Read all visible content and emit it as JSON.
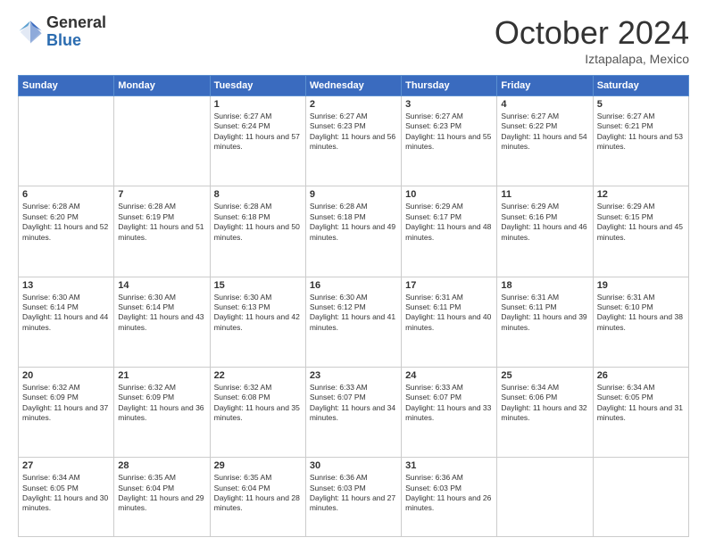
{
  "logo": {
    "general": "General",
    "blue": "Blue"
  },
  "header": {
    "month": "October 2024",
    "location": "Iztapalapa, Mexico"
  },
  "days_of_week": [
    "Sunday",
    "Monday",
    "Tuesday",
    "Wednesday",
    "Thursday",
    "Friday",
    "Saturday"
  ],
  "weeks": [
    [
      {
        "day": "",
        "info": ""
      },
      {
        "day": "",
        "info": ""
      },
      {
        "day": "1",
        "info": "Sunrise: 6:27 AM\nSunset: 6:24 PM\nDaylight: 11 hours and 57 minutes."
      },
      {
        "day": "2",
        "info": "Sunrise: 6:27 AM\nSunset: 6:23 PM\nDaylight: 11 hours and 56 minutes."
      },
      {
        "day": "3",
        "info": "Sunrise: 6:27 AM\nSunset: 6:23 PM\nDaylight: 11 hours and 55 minutes."
      },
      {
        "day": "4",
        "info": "Sunrise: 6:27 AM\nSunset: 6:22 PM\nDaylight: 11 hours and 54 minutes."
      },
      {
        "day": "5",
        "info": "Sunrise: 6:27 AM\nSunset: 6:21 PM\nDaylight: 11 hours and 53 minutes."
      }
    ],
    [
      {
        "day": "6",
        "info": "Sunrise: 6:28 AM\nSunset: 6:20 PM\nDaylight: 11 hours and 52 minutes."
      },
      {
        "day": "7",
        "info": "Sunrise: 6:28 AM\nSunset: 6:19 PM\nDaylight: 11 hours and 51 minutes."
      },
      {
        "day": "8",
        "info": "Sunrise: 6:28 AM\nSunset: 6:18 PM\nDaylight: 11 hours and 50 minutes."
      },
      {
        "day": "9",
        "info": "Sunrise: 6:28 AM\nSunset: 6:18 PM\nDaylight: 11 hours and 49 minutes."
      },
      {
        "day": "10",
        "info": "Sunrise: 6:29 AM\nSunset: 6:17 PM\nDaylight: 11 hours and 48 minutes."
      },
      {
        "day": "11",
        "info": "Sunrise: 6:29 AM\nSunset: 6:16 PM\nDaylight: 11 hours and 46 minutes."
      },
      {
        "day": "12",
        "info": "Sunrise: 6:29 AM\nSunset: 6:15 PM\nDaylight: 11 hours and 45 minutes."
      }
    ],
    [
      {
        "day": "13",
        "info": "Sunrise: 6:30 AM\nSunset: 6:14 PM\nDaylight: 11 hours and 44 minutes."
      },
      {
        "day": "14",
        "info": "Sunrise: 6:30 AM\nSunset: 6:14 PM\nDaylight: 11 hours and 43 minutes."
      },
      {
        "day": "15",
        "info": "Sunrise: 6:30 AM\nSunset: 6:13 PM\nDaylight: 11 hours and 42 minutes."
      },
      {
        "day": "16",
        "info": "Sunrise: 6:30 AM\nSunset: 6:12 PM\nDaylight: 11 hours and 41 minutes."
      },
      {
        "day": "17",
        "info": "Sunrise: 6:31 AM\nSunset: 6:11 PM\nDaylight: 11 hours and 40 minutes."
      },
      {
        "day": "18",
        "info": "Sunrise: 6:31 AM\nSunset: 6:11 PM\nDaylight: 11 hours and 39 minutes."
      },
      {
        "day": "19",
        "info": "Sunrise: 6:31 AM\nSunset: 6:10 PM\nDaylight: 11 hours and 38 minutes."
      }
    ],
    [
      {
        "day": "20",
        "info": "Sunrise: 6:32 AM\nSunset: 6:09 PM\nDaylight: 11 hours and 37 minutes."
      },
      {
        "day": "21",
        "info": "Sunrise: 6:32 AM\nSunset: 6:09 PM\nDaylight: 11 hours and 36 minutes."
      },
      {
        "day": "22",
        "info": "Sunrise: 6:32 AM\nSunset: 6:08 PM\nDaylight: 11 hours and 35 minutes."
      },
      {
        "day": "23",
        "info": "Sunrise: 6:33 AM\nSunset: 6:07 PM\nDaylight: 11 hours and 34 minutes."
      },
      {
        "day": "24",
        "info": "Sunrise: 6:33 AM\nSunset: 6:07 PM\nDaylight: 11 hours and 33 minutes."
      },
      {
        "day": "25",
        "info": "Sunrise: 6:34 AM\nSunset: 6:06 PM\nDaylight: 11 hours and 32 minutes."
      },
      {
        "day": "26",
        "info": "Sunrise: 6:34 AM\nSunset: 6:05 PM\nDaylight: 11 hours and 31 minutes."
      }
    ],
    [
      {
        "day": "27",
        "info": "Sunrise: 6:34 AM\nSunset: 6:05 PM\nDaylight: 11 hours and 30 minutes."
      },
      {
        "day": "28",
        "info": "Sunrise: 6:35 AM\nSunset: 6:04 PM\nDaylight: 11 hours and 29 minutes."
      },
      {
        "day": "29",
        "info": "Sunrise: 6:35 AM\nSunset: 6:04 PM\nDaylight: 11 hours and 28 minutes."
      },
      {
        "day": "30",
        "info": "Sunrise: 6:36 AM\nSunset: 6:03 PM\nDaylight: 11 hours and 27 minutes."
      },
      {
        "day": "31",
        "info": "Sunrise: 6:36 AM\nSunset: 6:03 PM\nDaylight: 11 hours and 26 minutes."
      },
      {
        "day": "",
        "info": ""
      },
      {
        "day": "",
        "info": ""
      }
    ]
  ]
}
